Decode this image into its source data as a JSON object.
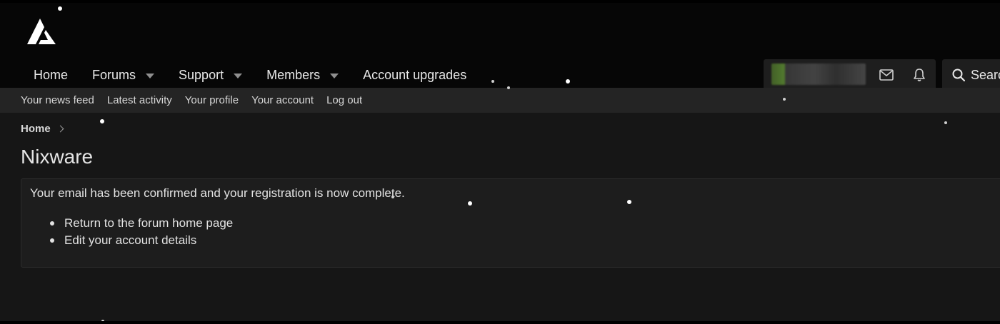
{
  "header": {
    "logo": "forum-logo",
    "nav": [
      {
        "label": "Home",
        "has_dropdown": false
      },
      {
        "label": "Forums",
        "has_dropdown": true
      },
      {
        "label": "Support",
        "has_dropdown": true
      },
      {
        "label": "Members",
        "has_dropdown": true
      },
      {
        "label": "Account upgrades",
        "has_dropdown": false
      }
    ],
    "user": {
      "avatar": "blurred-avatar",
      "inbox_icon": "envelope-icon",
      "alerts_icon": "bell-icon"
    },
    "search": {
      "icon": "search-icon",
      "label": "Search"
    }
  },
  "subnav": [
    "Your news feed",
    "Latest activity",
    "Your profile",
    "Your account",
    "Log out"
  ],
  "breadcrumb": {
    "items": [
      "Home"
    ]
  },
  "page_title": "Nixware",
  "message": {
    "text": "Your email has been confirmed and your registration is now complete.",
    "links": [
      "Return to the forum home page",
      "Edit your account details"
    ]
  },
  "colors": {
    "header_bg": "#060606",
    "subnav_bg": "#242424",
    "page_bg": "#161616",
    "block_bg": "#1d1d1d",
    "text": "#e6e6e6"
  }
}
